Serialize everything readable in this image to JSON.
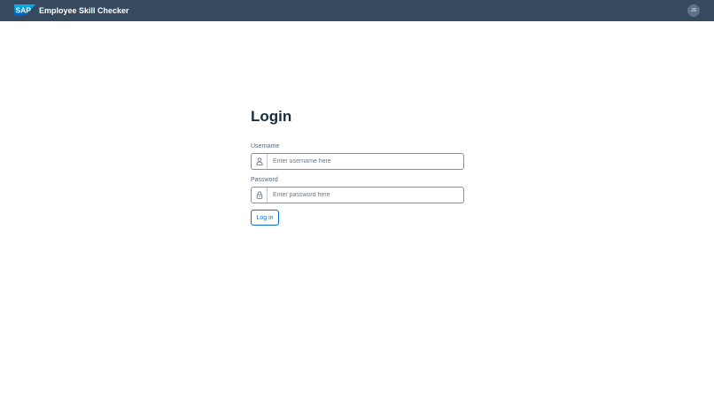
{
  "shell": {
    "brand": "SAP",
    "title": "Employee Skill Checker",
    "avatar_initials": "JS",
    "background_color": "#354a5f",
    "logo_color": "#0a6ed1"
  },
  "login": {
    "heading": "Login",
    "username": {
      "label": "Username",
      "placeholder": "Enter username here",
      "value": "",
      "icon": "person-icon"
    },
    "password": {
      "label": "Password",
      "placeholder": "Enter password here",
      "value": "",
      "icon": "lock-icon"
    },
    "submit_label": "Log in",
    "accent_color": "#0a6ed1"
  }
}
